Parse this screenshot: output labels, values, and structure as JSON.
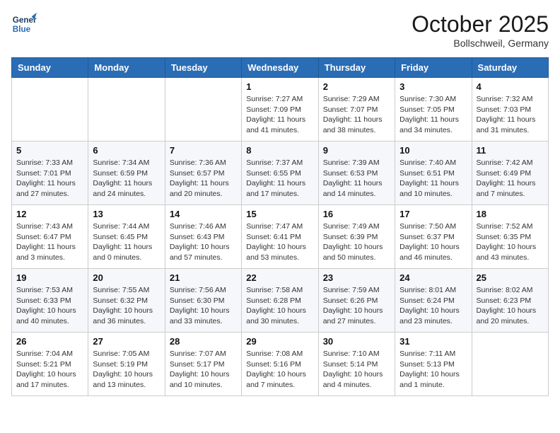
{
  "header": {
    "logo_line1": "General",
    "logo_line2": "Blue",
    "month": "October 2025",
    "location": "Bollschweil, Germany"
  },
  "weekdays": [
    "Sunday",
    "Monday",
    "Tuesday",
    "Wednesday",
    "Thursday",
    "Friday",
    "Saturday"
  ],
  "weeks": [
    [
      {
        "day": "",
        "info": ""
      },
      {
        "day": "",
        "info": ""
      },
      {
        "day": "",
        "info": ""
      },
      {
        "day": "1",
        "info": "Sunrise: 7:27 AM\nSunset: 7:09 PM\nDaylight: 11 hours\nand 41 minutes."
      },
      {
        "day": "2",
        "info": "Sunrise: 7:29 AM\nSunset: 7:07 PM\nDaylight: 11 hours\nand 38 minutes."
      },
      {
        "day": "3",
        "info": "Sunrise: 7:30 AM\nSunset: 7:05 PM\nDaylight: 11 hours\nand 34 minutes."
      },
      {
        "day": "4",
        "info": "Sunrise: 7:32 AM\nSunset: 7:03 PM\nDaylight: 11 hours\nand 31 minutes."
      }
    ],
    [
      {
        "day": "5",
        "info": "Sunrise: 7:33 AM\nSunset: 7:01 PM\nDaylight: 11 hours\nand 27 minutes."
      },
      {
        "day": "6",
        "info": "Sunrise: 7:34 AM\nSunset: 6:59 PM\nDaylight: 11 hours\nand 24 minutes."
      },
      {
        "day": "7",
        "info": "Sunrise: 7:36 AM\nSunset: 6:57 PM\nDaylight: 11 hours\nand 20 minutes."
      },
      {
        "day": "8",
        "info": "Sunrise: 7:37 AM\nSunset: 6:55 PM\nDaylight: 11 hours\nand 17 minutes."
      },
      {
        "day": "9",
        "info": "Sunrise: 7:39 AM\nSunset: 6:53 PM\nDaylight: 11 hours\nand 14 minutes."
      },
      {
        "day": "10",
        "info": "Sunrise: 7:40 AM\nSunset: 6:51 PM\nDaylight: 11 hours\nand 10 minutes."
      },
      {
        "day": "11",
        "info": "Sunrise: 7:42 AM\nSunset: 6:49 PM\nDaylight: 11 hours\nand 7 minutes."
      }
    ],
    [
      {
        "day": "12",
        "info": "Sunrise: 7:43 AM\nSunset: 6:47 PM\nDaylight: 11 hours\nand 3 minutes."
      },
      {
        "day": "13",
        "info": "Sunrise: 7:44 AM\nSunset: 6:45 PM\nDaylight: 11 hours\nand 0 minutes."
      },
      {
        "day": "14",
        "info": "Sunrise: 7:46 AM\nSunset: 6:43 PM\nDaylight: 10 hours\nand 57 minutes."
      },
      {
        "day": "15",
        "info": "Sunrise: 7:47 AM\nSunset: 6:41 PM\nDaylight: 10 hours\nand 53 minutes."
      },
      {
        "day": "16",
        "info": "Sunrise: 7:49 AM\nSunset: 6:39 PM\nDaylight: 10 hours\nand 50 minutes."
      },
      {
        "day": "17",
        "info": "Sunrise: 7:50 AM\nSunset: 6:37 PM\nDaylight: 10 hours\nand 46 minutes."
      },
      {
        "day": "18",
        "info": "Sunrise: 7:52 AM\nSunset: 6:35 PM\nDaylight: 10 hours\nand 43 minutes."
      }
    ],
    [
      {
        "day": "19",
        "info": "Sunrise: 7:53 AM\nSunset: 6:33 PM\nDaylight: 10 hours\nand 40 minutes."
      },
      {
        "day": "20",
        "info": "Sunrise: 7:55 AM\nSunset: 6:32 PM\nDaylight: 10 hours\nand 36 minutes."
      },
      {
        "day": "21",
        "info": "Sunrise: 7:56 AM\nSunset: 6:30 PM\nDaylight: 10 hours\nand 33 minutes."
      },
      {
        "day": "22",
        "info": "Sunrise: 7:58 AM\nSunset: 6:28 PM\nDaylight: 10 hours\nand 30 minutes."
      },
      {
        "day": "23",
        "info": "Sunrise: 7:59 AM\nSunset: 6:26 PM\nDaylight: 10 hours\nand 27 minutes."
      },
      {
        "day": "24",
        "info": "Sunrise: 8:01 AM\nSunset: 6:24 PM\nDaylight: 10 hours\nand 23 minutes."
      },
      {
        "day": "25",
        "info": "Sunrise: 8:02 AM\nSunset: 6:23 PM\nDaylight: 10 hours\nand 20 minutes."
      }
    ],
    [
      {
        "day": "26",
        "info": "Sunrise: 7:04 AM\nSunset: 5:21 PM\nDaylight: 10 hours\nand 17 minutes."
      },
      {
        "day": "27",
        "info": "Sunrise: 7:05 AM\nSunset: 5:19 PM\nDaylight: 10 hours\nand 13 minutes."
      },
      {
        "day": "28",
        "info": "Sunrise: 7:07 AM\nSunset: 5:17 PM\nDaylight: 10 hours\nand 10 minutes."
      },
      {
        "day": "29",
        "info": "Sunrise: 7:08 AM\nSunset: 5:16 PM\nDaylight: 10 hours\nand 7 minutes."
      },
      {
        "day": "30",
        "info": "Sunrise: 7:10 AM\nSunset: 5:14 PM\nDaylight: 10 hours\nand 4 minutes."
      },
      {
        "day": "31",
        "info": "Sunrise: 7:11 AM\nSunset: 5:13 PM\nDaylight: 10 hours\nand 1 minute."
      },
      {
        "day": "",
        "info": ""
      }
    ]
  ]
}
